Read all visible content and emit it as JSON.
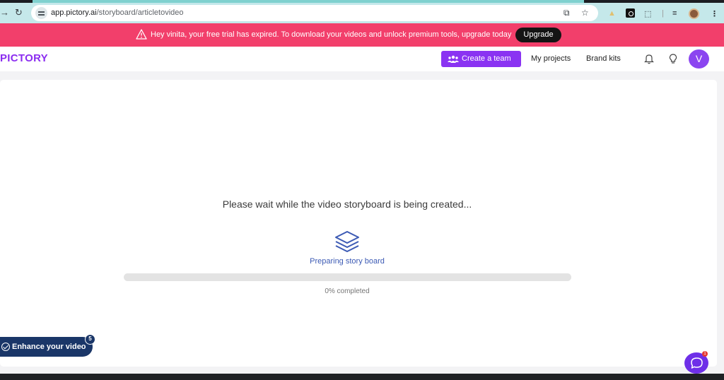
{
  "browser": {
    "url_host": "app.pictory.ai",
    "url_path": "/storyboard/articletovideo"
  },
  "banner": {
    "message": "Hey vinita, your free trial has expired. To download your videos and unlock premium tools, upgrade today",
    "upgrade_label": "Upgrade"
  },
  "header": {
    "logo": "PICTORY",
    "create_team_label": "Create a team",
    "my_projects_label": "My projects",
    "brand_kits_label": "Brand kits",
    "avatar_initial": "V"
  },
  "main": {
    "wait_message": "Please wait while the video storyboard is being created...",
    "status": "Preparing story board",
    "progress_percent": 0,
    "progress_text": "0% completed"
  },
  "enhance": {
    "label": "Enhance your video",
    "badge": "5"
  },
  "chat": {
    "badge": "1"
  },
  "colors": {
    "brand_purple": "#8a33f2",
    "banner_pink": "#f23f6b",
    "navy": "#1a3668"
  }
}
